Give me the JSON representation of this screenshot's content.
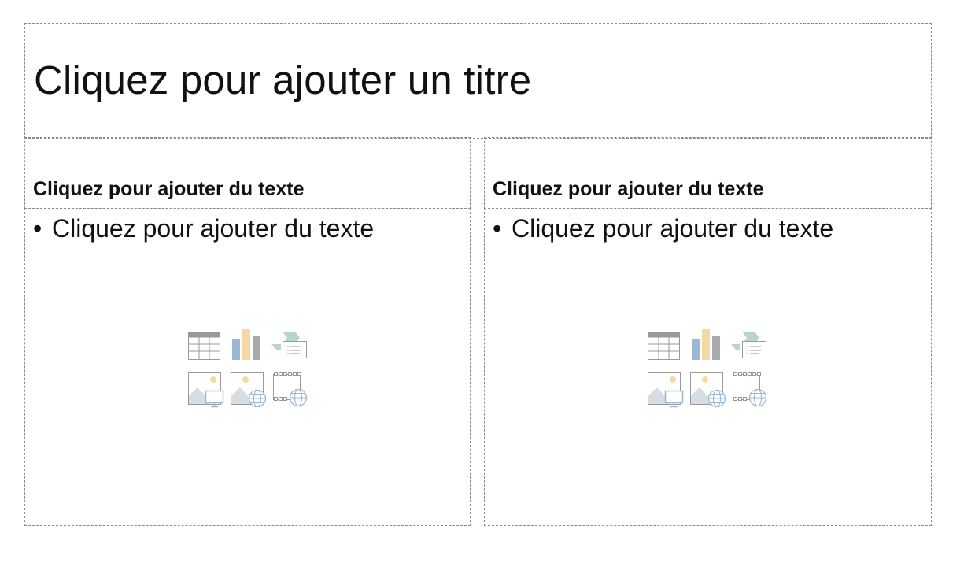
{
  "slide": {
    "title_placeholder": "Cliquez pour ajouter un titre",
    "left": {
      "header_placeholder": "Cliquez pour ajouter du texte",
      "body_bullet": "Cliquez pour ajouter du texte",
      "content_icons": [
        "insert-table-icon",
        "insert-chart-icon",
        "insert-smartart-icon",
        "insert-picture-icon",
        "insert-online-picture-icon",
        "insert-video-icon"
      ]
    },
    "right": {
      "header_placeholder": "Cliquez pour ajouter du texte",
      "body_bullet": "Cliquez pour ajouter du texte",
      "content_icons": [
        "insert-table-icon",
        "insert-chart-icon",
        "insert-smartart-icon",
        "insert-picture-icon",
        "insert-online-picture-icon",
        "insert-video-icon"
      ]
    },
    "colors": {
      "placeholder_border": "#8a8a8a",
      "icon_gray": "#9a9a9a",
      "icon_blue": "#9bb7d4",
      "icon_tan": "#f2d9a6",
      "icon_green": "#b8d6c8"
    }
  }
}
